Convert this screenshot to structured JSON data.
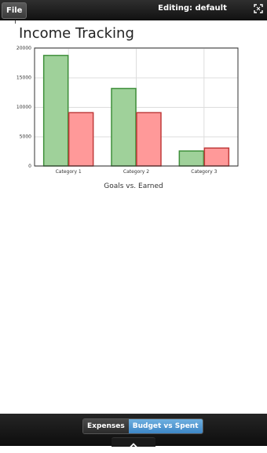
{
  "header": {
    "file_label": "File",
    "editing_label": "Editing: default"
  },
  "page": {
    "title": "Income Tracking",
    "caption": "Goals vs. Earned"
  },
  "chart_data": {
    "type": "bar",
    "categories": [
      "Category 1",
      "Category 2",
      "Category 3"
    ],
    "series": [
      {
        "values": [
          18800,
          13200,
          2600
        ],
        "fill": "#9fd19a",
        "stroke": "#3f8f3a"
      },
      {
        "values": [
          9100,
          9100,
          3100
        ],
        "fill": "#ff9999",
        "stroke": "#c03b3b"
      }
    ],
    "ylim": [
      0,
      20000
    ],
    "yticks": [
      0,
      5000,
      10000,
      15000,
      20000
    ],
    "ytick_labels": [
      "0",
      "5000",
      "10000",
      "15000",
      "20000"
    ],
    "grid": true,
    "legend": "none",
    "title": "",
    "xlabel": "",
    "ylabel": ""
  },
  "bottom_tabs": {
    "expenses_label": "Expenses",
    "budget_label": "Budget vs Spent"
  },
  "icons": {
    "fullscreen": "fullscreen-icon",
    "chevron": "chevron-up-icon"
  },
  "colors": {
    "active_tab": "#4a94d0",
    "bar_bg": "#111111"
  }
}
